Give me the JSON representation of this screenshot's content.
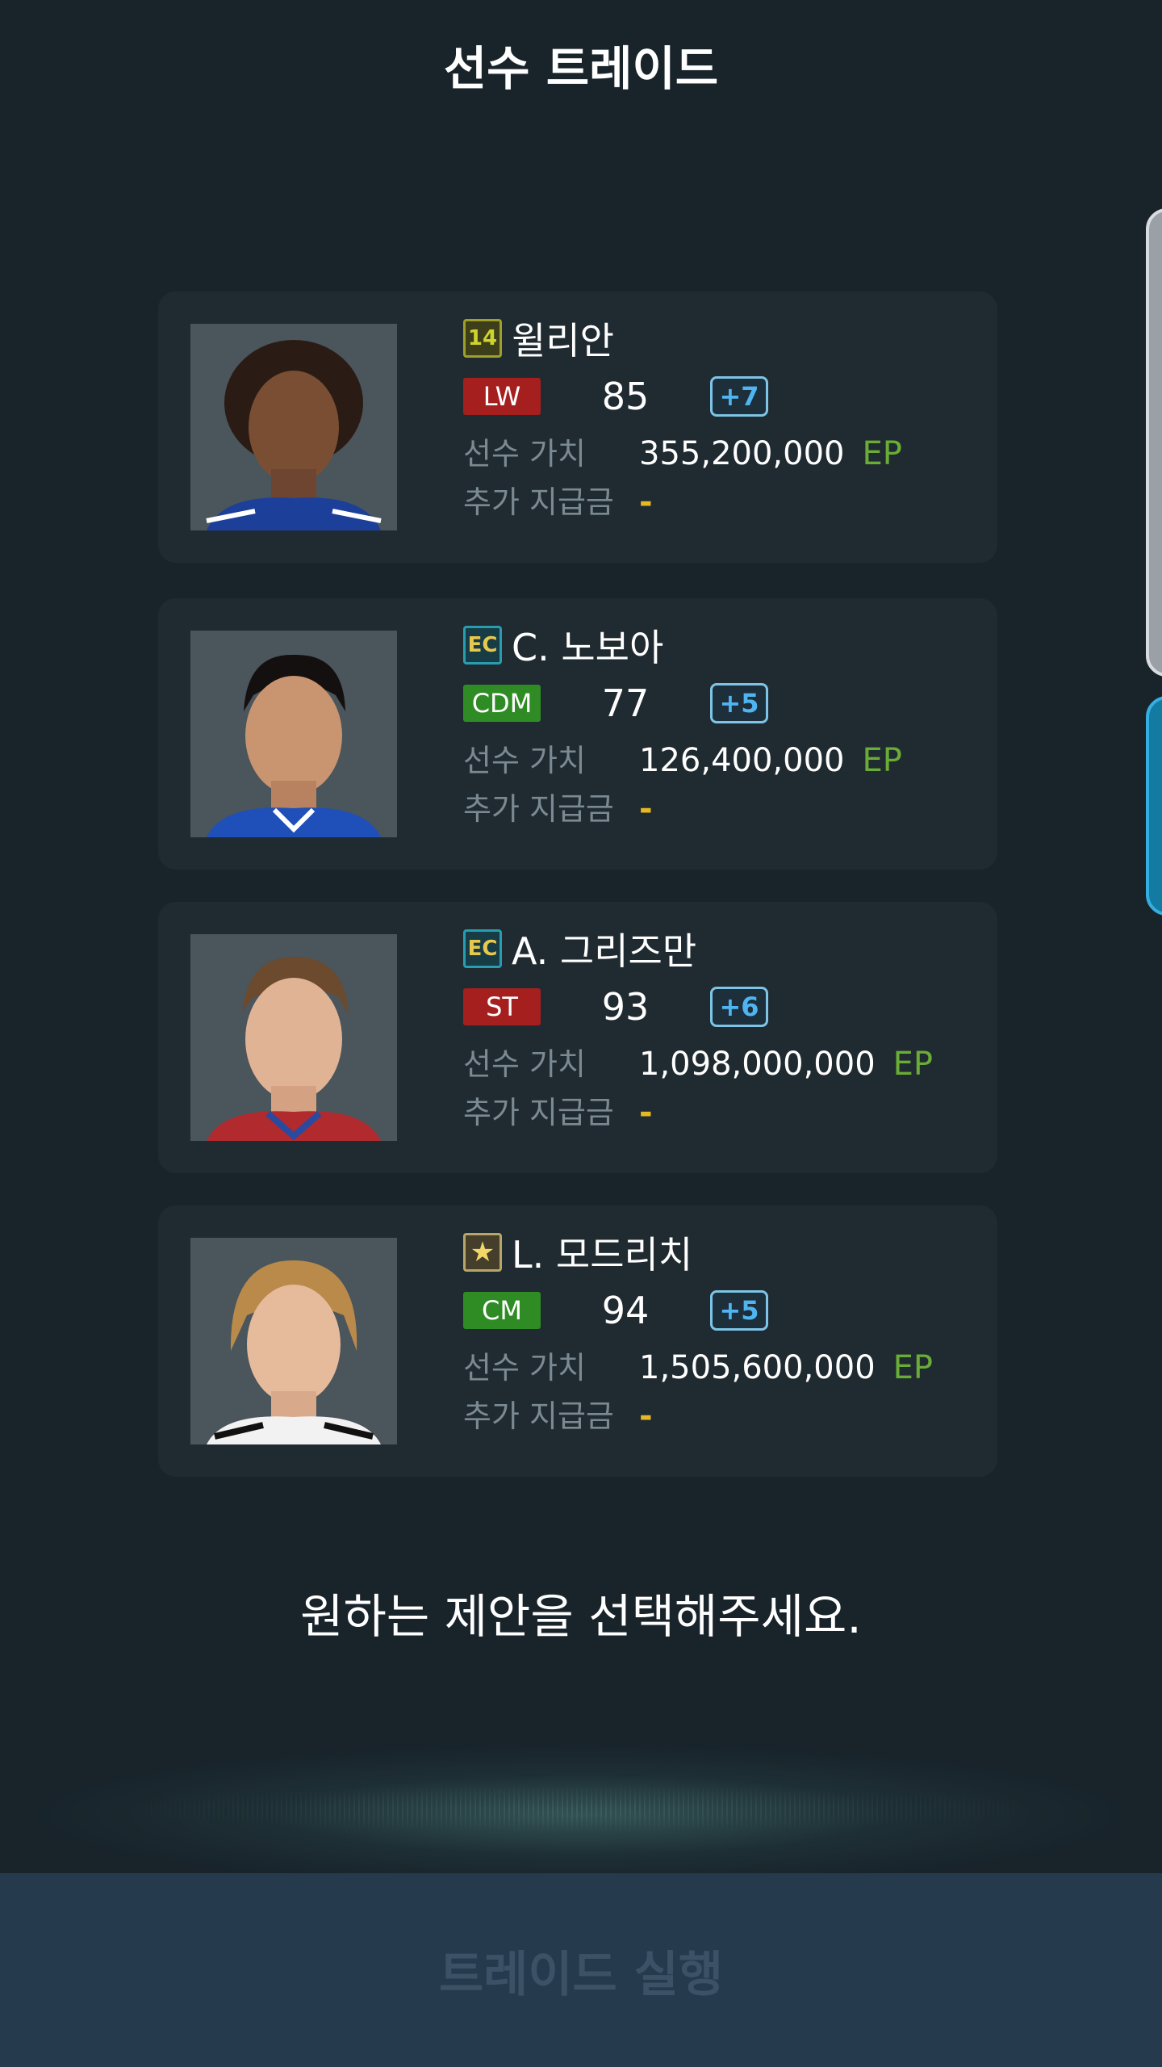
{
  "header": {
    "title": "선수 트레이드"
  },
  "players": [
    {
      "season": "14",
      "name": "윌리안",
      "position": "LW",
      "position_color": "red",
      "ovr": "85",
      "upgrade": "+7",
      "value_label": "선수 가치",
      "value": "355,200,000",
      "currency": "EP",
      "extra_label": "추가 지급금",
      "extra": "-"
    },
    {
      "season": "EC",
      "name": "C. 노보아",
      "position": "CDM",
      "position_color": "green",
      "ovr": "77",
      "upgrade": "+5",
      "value_label": "선수 가치",
      "value": "126,400,000",
      "currency": "EP",
      "extra_label": "추가 지급금",
      "extra": "-"
    },
    {
      "season": "EC",
      "name": "A. 그리즈만",
      "position": "ST",
      "position_color": "red",
      "ovr": "93",
      "upgrade": "+6",
      "value_label": "선수 가치",
      "value": "1,098,000,000",
      "currency": "EP",
      "extra_label": "추가 지급금",
      "extra": "-"
    },
    {
      "season": "★",
      "name": "L. 모드리치",
      "position": "CM",
      "position_color": "green",
      "ovr": "94",
      "upgrade": "+5",
      "value_label": "선수 가치",
      "value": "1,505,600,000",
      "currency": "EP",
      "extra_label": "추가 지급금",
      "extra": "-"
    }
  ],
  "prompt": "원하는 제안을 선택해주세요.",
  "footer": {
    "trade_button_label": "트레이드 실행"
  },
  "colors": {
    "background": "#18232a",
    "card": "#202b31",
    "ep_green": "#6aad36",
    "extra_yellow": "#e6b821",
    "bottom_bar": "#263a4e"
  }
}
